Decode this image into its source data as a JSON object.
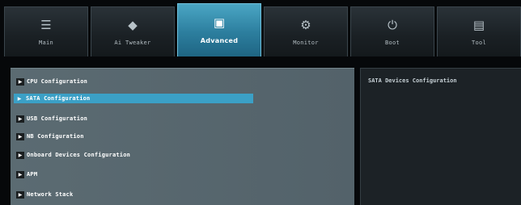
{
  "tabs": [
    {
      "label": "Main",
      "icon": "list-icon",
      "glyph": "☰"
    },
    {
      "label": "Ai Tweaker",
      "icon": "tweaker-icon",
      "glyph": "◆"
    },
    {
      "label": "Advanced",
      "icon": "advanced-icon",
      "glyph": "▣"
    },
    {
      "label": "Monitor",
      "icon": "monitor-icon",
      "glyph": "⚙"
    },
    {
      "label": "Boot",
      "icon": "power-icon",
      "glyph": "⏻"
    },
    {
      "label": "Tool",
      "icon": "tool-icon",
      "glyph": "▤"
    }
  ],
  "active_tab": "Advanced",
  "menu": {
    "items": [
      {
        "label": "CPU Configuration"
      },
      {
        "label": "SATA Configuration"
      },
      {
        "label": "USB Configuration"
      },
      {
        "label": "NB Configuration"
      },
      {
        "label": "Onboard Devices Configuration"
      },
      {
        "label": "APM"
      },
      {
        "label": "Network Stack"
      }
    ],
    "selected_index": 1
  },
  "help": {
    "text": "SATA Devices Configuration"
  },
  "colors": {
    "accent": "#3ba0c6",
    "background": "#06080a",
    "panel": "#56666d",
    "help_panel": "#1c2226"
  }
}
